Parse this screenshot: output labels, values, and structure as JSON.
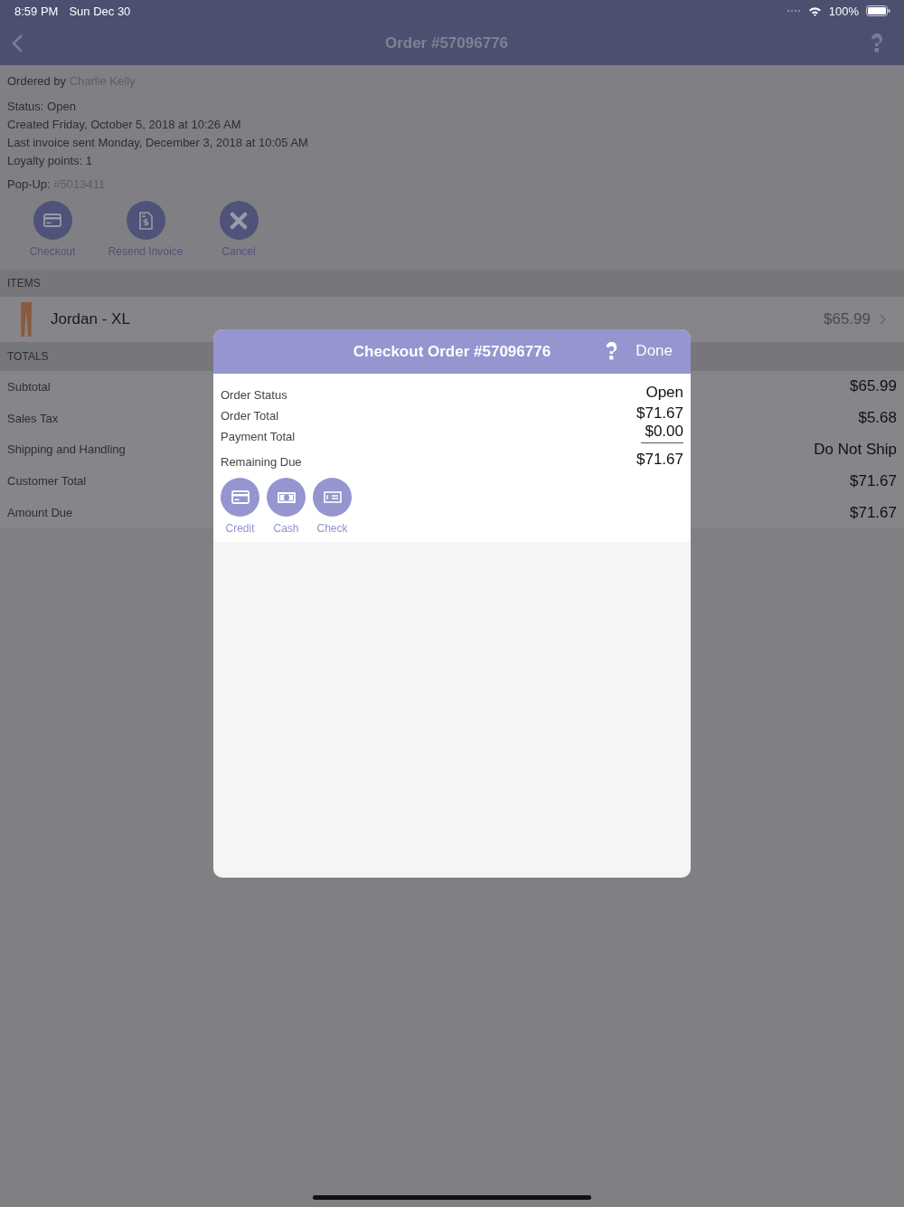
{
  "status_bar": {
    "time": "8:59 PM",
    "date": "Sun Dec 30",
    "battery": "100%"
  },
  "nav": {
    "title": "Order #57096776"
  },
  "order": {
    "ordered_by_label": "Ordered by",
    "ordered_by": "Charlie Kelly",
    "info": [
      "Status: Open",
      "Created Friday, October 5, 2018 at 10:26 AM",
      "Last invoice sent Monday, December 3, 2018 at 10:05 AM",
      "Loyalty points: 1"
    ],
    "popup_label": "Pop-Up:",
    "popup": "#5013411"
  },
  "actions": [
    {
      "label": "Checkout",
      "kind": "card"
    },
    {
      "label": "Resend Invoice",
      "kind": "invoice"
    },
    {
      "label": "Cancel",
      "kind": "cancel"
    }
  ],
  "items_header": "ITEMS",
  "items": [
    {
      "name": "Jordan - XL",
      "price": "$65.99"
    }
  ],
  "totals_header": "TOTALS",
  "totals": [
    {
      "label": "Subtotal",
      "value": "$65.99"
    },
    {
      "label": "Sales Tax",
      "value": "$5.68"
    },
    {
      "label": "Shipping and Handling",
      "value": "Do Not Ship"
    },
    {
      "label": "Customer Total",
      "value": "$71.67"
    },
    {
      "label": "Amount Due",
      "value": "$71.67"
    }
  ],
  "modal": {
    "title": "Checkout Order #57096776",
    "done": "Done",
    "summary": [
      {
        "label": "Order Status",
        "value": "Open",
        "ruled": false
      },
      {
        "label": "Order Total",
        "value": "$71.67",
        "ruled": false
      },
      {
        "label": "Payment Total",
        "value": "$0.00",
        "ruled": true
      },
      {
        "label": "Remaining Due",
        "value": "$71.67",
        "ruled": false
      }
    ],
    "methods": [
      {
        "label": "Credit",
        "kind": "credit"
      },
      {
        "label": "Cash",
        "kind": "cash"
      },
      {
        "label": "Check",
        "kind": "check"
      }
    ]
  }
}
